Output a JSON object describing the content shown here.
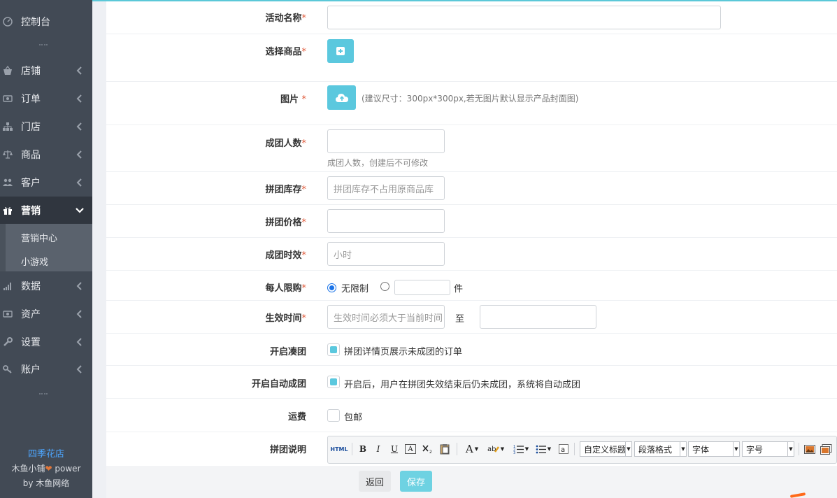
{
  "sidebar": {
    "dashboard": "控制台",
    "items": [
      {
        "label": "店铺",
        "icon": "basket-icon"
      },
      {
        "label": "订单",
        "icon": "money-icon"
      },
      {
        "label": "门店",
        "icon": "sitemap-icon"
      },
      {
        "label": "商品",
        "icon": "scale-icon"
      },
      {
        "label": "客户",
        "icon": "users-icon"
      },
      {
        "label": "营销",
        "icon": "gift-icon"
      },
      {
        "label": "数据",
        "icon": "bar-chart-icon"
      },
      {
        "label": "资产",
        "icon": "money-icon"
      },
      {
        "label": "设置",
        "icon": "wrench-icon"
      },
      {
        "label": "账户",
        "icon": "key-icon"
      }
    ],
    "submenu": [
      "营销中心",
      "小游戏"
    ],
    "footer": {
      "shop_name": "四季花店",
      "power_prefix": "木鱼小铺",
      "power_suffix": "power",
      "by_prefix": "by",
      "by_name": "木鱼网络"
    }
  },
  "form": {
    "activity_name": {
      "label": "活动名称",
      "value": ""
    },
    "select_product": {
      "label": "选择商品"
    },
    "image": {
      "label": "图片",
      "hint": "(建议尺寸：300px*300px,若无图片默认显示产品封面图)"
    },
    "group_size": {
      "label": "成团人数",
      "value": "",
      "hint": "成团人数，创建后不可修改"
    },
    "group_stock": {
      "label": "拼团库存",
      "placeholder": "拼团库存不占用原商品库"
    },
    "group_price": {
      "label": "拼团价格",
      "value": ""
    },
    "group_duration": {
      "label": "成团时效",
      "placeholder": "小时"
    },
    "purchase_limit": {
      "label": "每人限购",
      "option_unlimited": "无限制",
      "unit": "件",
      "selected": "无限制"
    },
    "effective_time": {
      "label": "生效时间",
      "start_placeholder": "生效时间必须大于当前时间",
      "separator": "至"
    },
    "open_join": {
      "label": "开启凑团",
      "text": "拼团详情页展示未成团的订单",
      "checked": true
    },
    "auto_group": {
      "label": "开启自动成团",
      "text": "开启后，用户在拼团失效结束后仍未成团，系统将自动成团",
      "checked": true
    },
    "shipping": {
      "label": "运费",
      "text": "包邮",
      "checked": false
    },
    "description": {
      "label": "拼团说明"
    }
  },
  "required_mark": "*",
  "editor": {
    "html_btn": "HTML",
    "bold": "B",
    "italic": "I",
    "underline": "U",
    "fontcolor": "A",
    "heading_select": "自定义标题",
    "paragraph_select": "段落格式",
    "font_select": "字体",
    "size_select": "字号"
  },
  "actions": {
    "back": "返回",
    "save": "保存"
  },
  "colors": {
    "accent": "#5bc8de",
    "sidebar_bg": "#424a55",
    "required": "#e05a3a",
    "shop_link": "#4da6ff"
  }
}
